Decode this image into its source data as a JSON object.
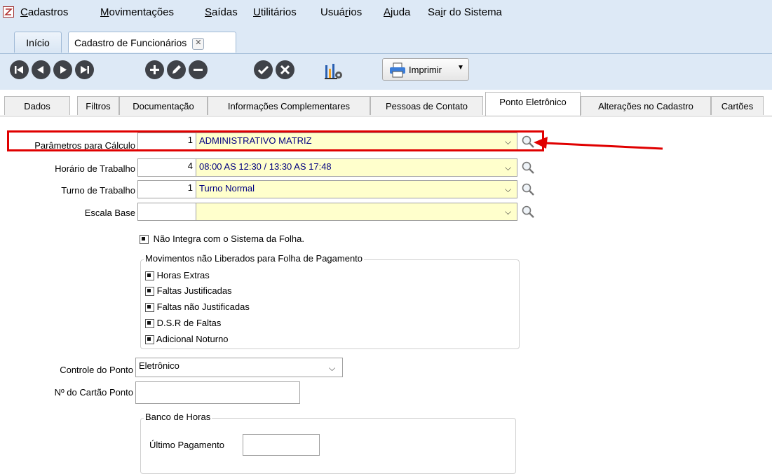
{
  "menu": {
    "items": [
      {
        "pre": "",
        "u": "C",
        "post": "adastros"
      },
      {
        "pre": "",
        "u": "M",
        "post": "ovimentações"
      },
      {
        "pre": "",
        "u": "S",
        "post": "aídas"
      },
      {
        "pre": "",
        "u": "U",
        "post": "tilitários"
      },
      {
        "pre": "Usuá",
        "u": "r",
        "post": "ios"
      },
      {
        "pre": "",
        "u": "A",
        "post": "juda"
      },
      {
        "pre": "Sa",
        "u": "i",
        "post": "r do Sistema"
      }
    ]
  },
  "doc_tabs": {
    "home": "Início",
    "current": "Cadastro de Funcionários",
    "close_glyph": "✕"
  },
  "toolbar": {
    "print_label": "Imprimir"
  },
  "section_tabs": [
    "Dados",
    "Filtros",
    "Documentação",
    "Informações Complementares",
    "Pessoas de Contato",
    "Ponto Eletrônico",
    "Alterações no Cadastro",
    "Cartões"
  ],
  "active_section_tab": "Ponto Eletrônico",
  "form": {
    "parametros": {
      "label": "Parâmetros para Cálculo",
      "code": "1",
      "value": "ADMINISTRATIVO MATRIZ"
    },
    "horario": {
      "label": "Horário de Trabalho",
      "code": "4",
      "value": "08:00 AS 12:30 / 13:30 AS 17:48"
    },
    "turno": {
      "label": "Turno de Trabalho",
      "code": "1",
      "value": "Turno Normal"
    },
    "escala": {
      "label": "Escala Base",
      "code": "",
      "value": ""
    },
    "nao_integra": "Não Integra com o Sistema da Folha.",
    "movimentos_group": {
      "title": "Movimentos não Liberados para Folha de Pagamento",
      "items": [
        "Horas Extras",
        "Faltas Justificadas",
        "Faltas não Justificadas",
        "D.S.R de Faltas",
        "Adicional Noturno"
      ]
    },
    "controle_ponto": {
      "label": "Controle do Ponto",
      "value": "Eletrônico"
    },
    "cartao_ponto": {
      "label": "Nº do Cartão Ponto",
      "value": ""
    },
    "banco_horas": {
      "title": "Banco de Horas",
      "ultimo_pagamento_label": "Último Pagamento",
      "ultimo_pagamento_value": ""
    }
  },
  "colors": {
    "highlight": "#e00000",
    "lookup_bg": "#ffffcc",
    "lookup_text": "#000080",
    "toolbar_bg": "#dde9f6"
  }
}
